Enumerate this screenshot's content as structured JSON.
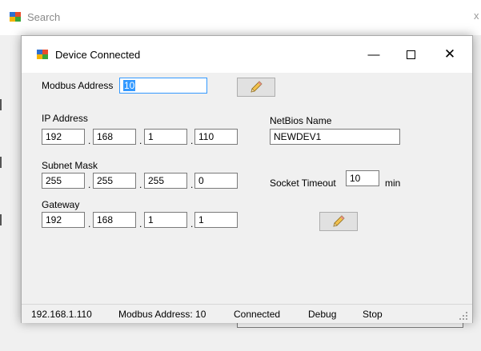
{
  "background_window": {
    "title": "Search",
    "close_glyph": "x"
  },
  "dialog": {
    "title": "Device Connected",
    "controls": {
      "minimize": "—",
      "close": "✕"
    }
  },
  "form": {
    "modbus_address": {
      "label": "Modbus Address",
      "value": "10"
    },
    "ip_address": {
      "label": "IP Address",
      "octets": [
        "192",
        "168",
        "1",
        "110"
      ]
    },
    "subnet_mask": {
      "label": "Subnet Mask",
      "octets": [
        "255",
        "255",
        "255",
        "0"
      ]
    },
    "gateway": {
      "label": "Gateway",
      "octets": [
        "192",
        "168",
        "1",
        "1"
      ]
    },
    "netbios_name": {
      "label": "NetBios Name",
      "value": "NEWDEV1"
    },
    "socket_timeout": {
      "label": "Socket Timeout",
      "value": "10",
      "unit": "min"
    },
    "octet_separator": "."
  },
  "buttons": {
    "edit_modbus_icon": "pencil-icon",
    "edit_network_icon": "pencil-icon"
  },
  "statusbar": {
    "ip": "192.168.1.110",
    "modbus": "Modbus Address: 10",
    "state": "Connected",
    "debug": "Debug",
    "stop": "Stop"
  },
  "colors": {
    "selection": "#3399ff",
    "titlebar": "#ffffff",
    "window_bg": "#f0f0f0"
  }
}
